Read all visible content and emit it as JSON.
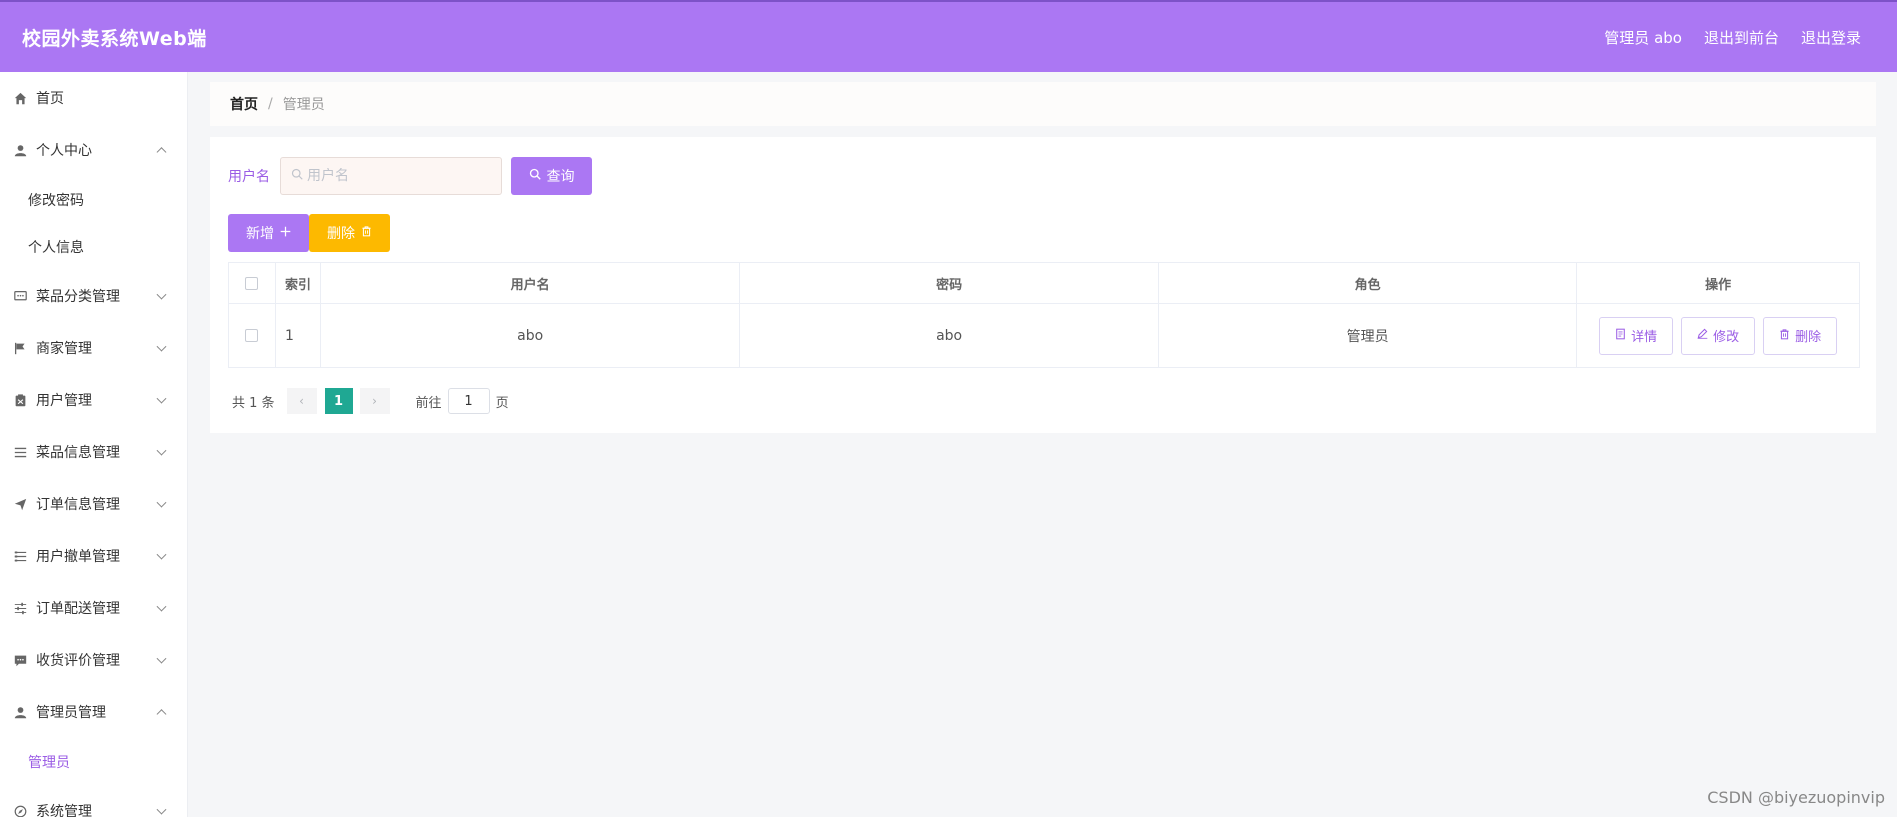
{
  "header": {
    "title": "校园外卖系统Web端",
    "user_label": "管理员 abo",
    "to_front": "退出到前台",
    "logout": "退出登录"
  },
  "sidebar": {
    "home": "首页",
    "personal_center": "个人中心",
    "change_password": "修改密码",
    "personal_info": "个人信息",
    "dish_category": "菜品分类管理",
    "merchant": "商家管理",
    "user": "用户管理",
    "dish_info": "菜品信息管理",
    "order_info": "订单信息管理",
    "user_cancel": "用户撤单管理",
    "order_delivery": "订单配送管理",
    "review": "收货评价管理",
    "admin_mgmt": "管理员管理",
    "admin": "管理员",
    "system": "系统管理"
  },
  "breadcrumb": {
    "home": "首页",
    "sep": "/",
    "current": "管理员"
  },
  "search": {
    "label": "用户名",
    "placeholder": "用户名",
    "query_button": "查询"
  },
  "toolbar": {
    "add": "新增",
    "delete": "删除"
  },
  "table": {
    "columns": [
      "索引",
      "用户名",
      "密码",
      "角色",
      "操作"
    ],
    "rows": [
      {
        "index": "1",
        "username": "abo",
        "password": "abo",
        "role": "管理员"
      }
    ],
    "actions": {
      "detail": "详情",
      "edit": "修改",
      "delete": "删除"
    }
  },
  "pagination": {
    "total": "共 1 条",
    "current_page": "1",
    "goto_label": "前往",
    "goto_value": "1",
    "page_unit": "页"
  },
  "watermark": "CSDN @biyezuopinvip",
  "colors": {
    "header": "#ab77f3",
    "add_button": "#ab77f3",
    "delete_button": "#fdb900",
    "active_page": "#1fa893"
  }
}
